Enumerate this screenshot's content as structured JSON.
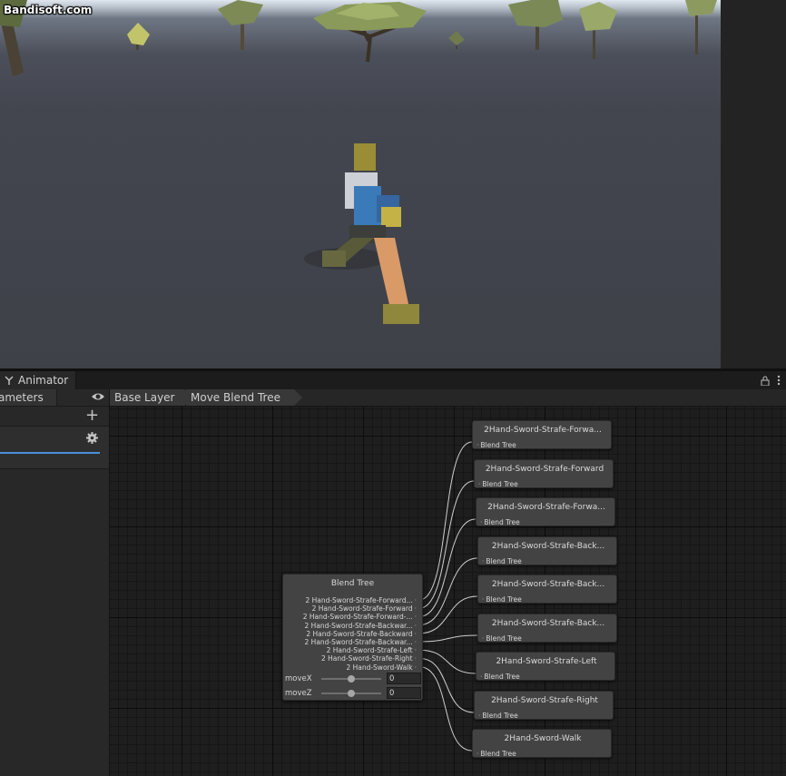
{
  "watermark": "Bandisoft.com",
  "window": {
    "tab_title": "Animator",
    "tab_icon": "animator-icon",
    "lock_icon": "lock-icon",
    "menu_icon": "kebab-menu-icon"
  },
  "left_panel": {
    "parameters_tab": "ameters",
    "visibility_icon": "eye-icon",
    "add_icon": "plus-icon",
    "settings_icon": "gear-icon",
    "accent_color": "#4a8fd8"
  },
  "breadcrumb": [
    "Base Layer",
    "Move Blend Tree"
  ],
  "blend_tree": {
    "title": "Blend Tree",
    "children": [
      "2 Hand-Sword-Strafe-Forward...",
      "2 Hand-Sword-Strafe-Forward",
      "2 Hand-Sword-Strafe-Forward-...",
      "2 Hand-Sword-Strafe-Backwar...",
      "2 Hand-Sword-Strafe-Backward",
      "2 Hand-Sword-Strafe-Backwar...",
      "2 Hand-Sword-Strafe-Left",
      "2 Hand-Sword-Strafe-Right",
      "2 Hand-Sword-Walk"
    ],
    "params": [
      {
        "name": "moveX",
        "value": "0",
        "slider": 0.5
      },
      {
        "name": "moveZ",
        "value": "0",
        "slider": 0.5
      }
    ]
  },
  "motion_nodes": [
    {
      "title": "2Hand-Sword-Strafe-Forwa...",
      "sub": "Blend Tree"
    },
    {
      "title": "2Hand-Sword-Strafe-Forward",
      "sub": "Blend Tree"
    },
    {
      "title": "2Hand-Sword-Strafe-Forwa...",
      "sub": "Blend Tree"
    },
    {
      "title": "2Hand-Sword-Strafe-Back...",
      "sub": "Blend Tree"
    },
    {
      "title": "2Hand-Sword-Strafe-Back...",
      "sub": "Blend Tree"
    },
    {
      "title": "2Hand-Sword-Strafe-Back...",
      "sub": "Blend Tree"
    },
    {
      "title": "2Hand-Sword-Strafe-Left",
      "sub": "Blend Tree"
    },
    {
      "title": "2Hand-Sword-Strafe-Right",
      "sub": "Blend Tree"
    },
    {
      "title": "2Hand-Sword-Walk",
      "sub": "Blend Tree"
    }
  ]
}
